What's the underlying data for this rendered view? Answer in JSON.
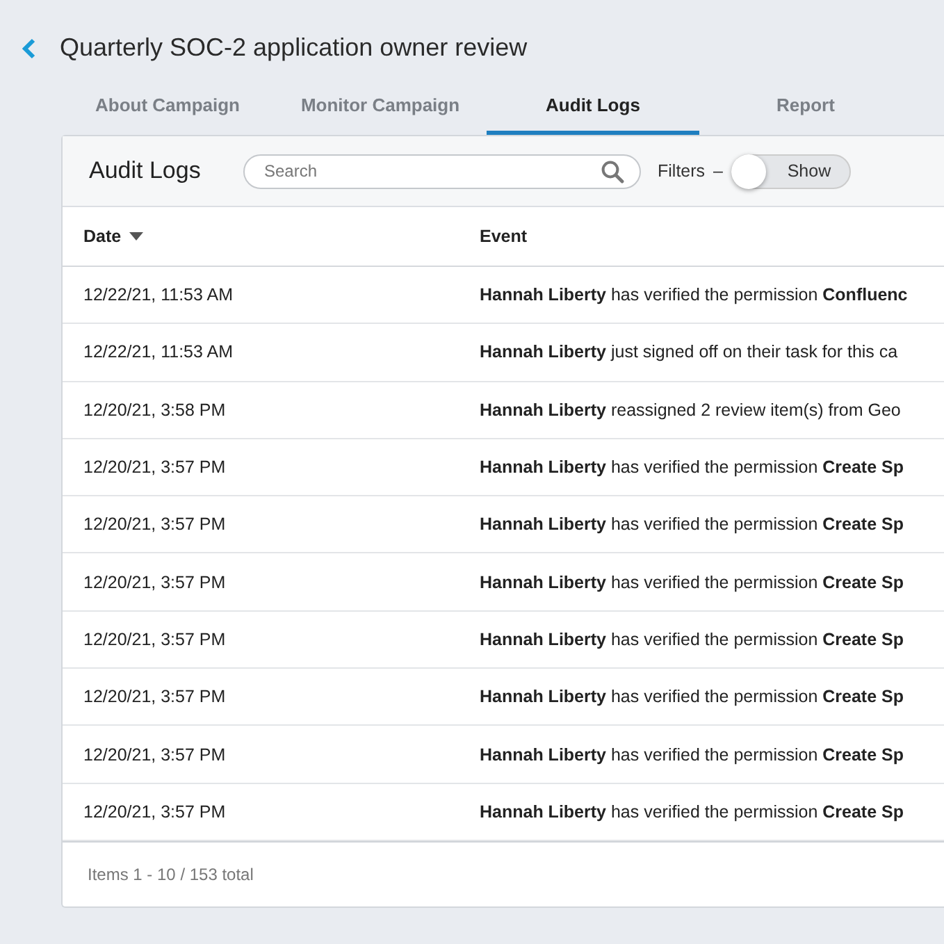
{
  "header": {
    "title": "Quarterly SOC-2 application owner review"
  },
  "tabs": [
    {
      "label": "About Campaign",
      "selected": false
    },
    {
      "label": "Monitor Campaign",
      "selected": false
    },
    {
      "label": "Audit Logs",
      "selected": true
    },
    {
      "label": "Report",
      "selected": false
    }
  ],
  "panel": {
    "title": "Audit Logs",
    "search": {
      "placeholder": "Search"
    },
    "filters": {
      "label": "Filters",
      "separator": "–",
      "toggle_label": "Show",
      "on": false
    }
  },
  "table": {
    "columns": [
      "Date",
      "Event"
    ],
    "rows": [
      {
        "date": "12/22/21, 11:53 AM",
        "event": "**Hannah Liberty** has verified the permission **Confluenc**"
      },
      {
        "date": "12/22/21, 11:53 AM",
        "event": "**Hannah Liberty** just signed off on their task for this ca"
      },
      {
        "date": "12/20/21, 3:58 PM",
        "event": "**Hannah Liberty** reassigned 2 review item(s) from Geo"
      },
      {
        "date": "12/20/21, 3:57 PM",
        "event": "**Hannah Liberty** has verified the permission **Create Sp**"
      },
      {
        "date": "12/20/21, 3:57 PM",
        "event": "**Hannah Liberty** has verified the permission **Create Sp**"
      },
      {
        "date": "12/20/21, 3:57 PM",
        "event": "**Hannah Liberty** has verified the permission **Create Sp**"
      },
      {
        "date": "12/20/21, 3:57 PM",
        "event": "**Hannah Liberty** has verified the permission **Create Sp**"
      },
      {
        "date": "12/20/21, 3:57 PM",
        "event": "**Hannah Liberty** has verified the permission **Create Sp**"
      },
      {
        "date": "12/20/21, 3:57 PM",
        "event": "**Hannah Liberty** has verified the permission **Create Sp**"
      },
      {
        "date": "12/20/21, 3:57 PM",
        "event": "**Hannah Liberty** has verified the permission **Create Sp**"
      }
    ]
  },
  "footer": {
    "summary": "Items 1 - 10 / 153 total"
  }
}
